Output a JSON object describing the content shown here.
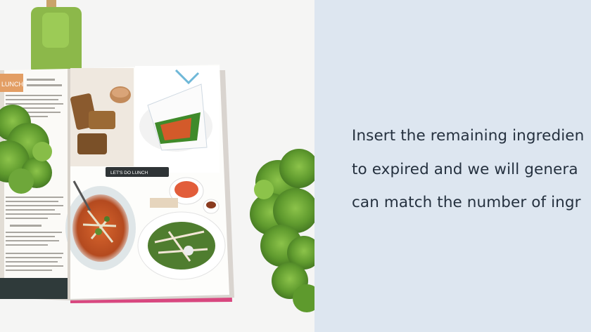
{
  "image": {
    "subject": "recipe-magazine-with-lettuce",
    "book": {
      "section_tag": "LUNCH",
      "banner_label": "LET'S DO LUNCH"
    }
  },
  "panel": {
    "lines": [
      "Insert the remaining ingredien",
      "to expired and we will genera",
      "can match the number of ingr"
    ]
  },
  "colors": {
    "panel_background": "#dde6f0",
    "text": "#25313f",
    "spatula": "#8cb84a",
    "lettuce": "#5f9a2e",
    "magazine_edge": "#d8477f"
  }
}
